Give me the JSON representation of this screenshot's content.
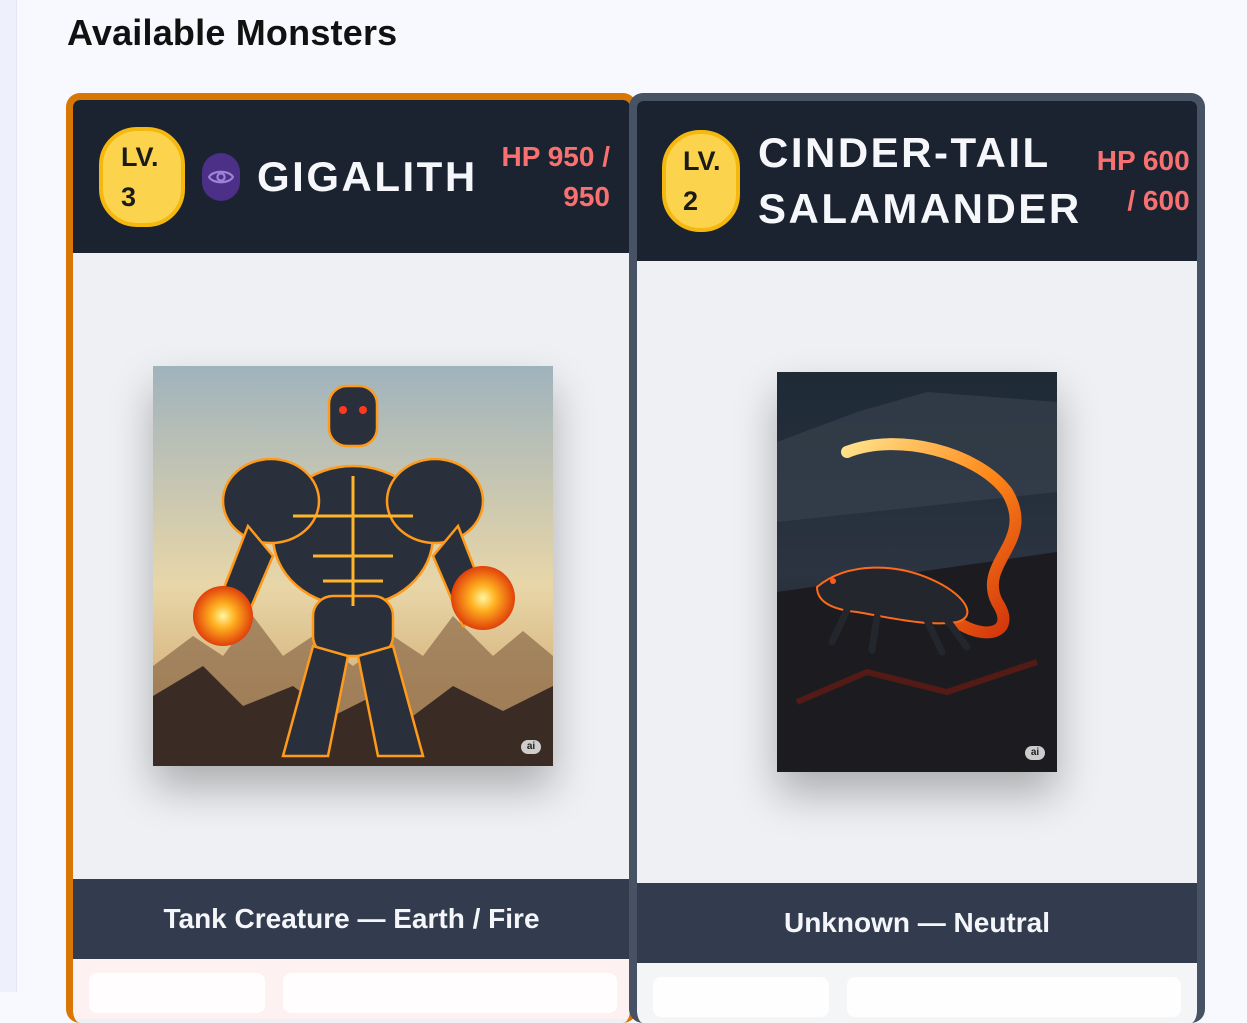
{
  "page": {
    "title": "Available Monsters"
  },
  "monsters": [
    {
      "level_label": "LV.",
      "level_value": "3",
      "name": "GIGALITH",
      "hp_line1": "HP 950 /",
      "hp_line2": "950",
      "icon": "eye-icon",
      "image_badge": "ai",
      "descriptor": "Tank Creature — Earth / Fire",
      "accent_color": "#d97706"
    },
    {
      "level_label": "LV.",
      "level_value": "2",
      "name_line1": "CINDER-TAIL",
      "name_line2": "SALAMANDER",
      "hp_line1": "HP 600",
      "hp_line2": "/ 600",
      "image_badge": "ai",
      "descriptor": "Unknown — Neutral",
      "accent_color": "#475265"
    }
  ],
  "colors": {
    "header_bg": "#1b2230",
    "level_badge": "#fcd34d",
    "hp_text": "#f87171",
    "footer_bg": "#323c4e"
  }
}
